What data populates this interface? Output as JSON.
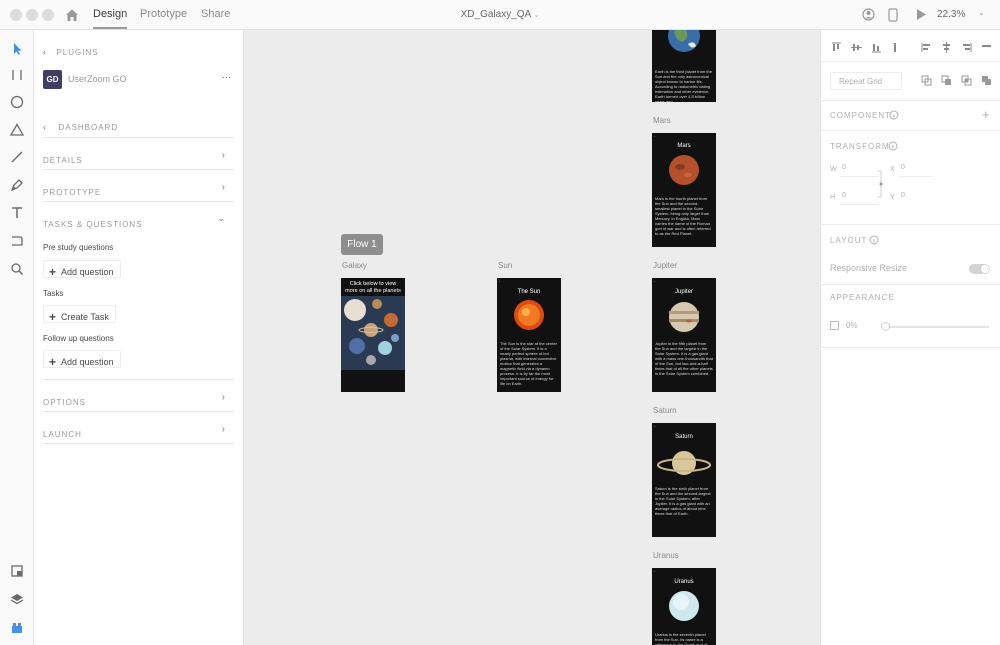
{
  "titlebar": {
    "tabs": [
      "Design",
      "Prototype",
      "Share"
    ],
    "document_title": "XD_Galaxy_QA",
    "zoom": "22.3%"
  },
  "plugin_panel": {
    "header": "PLUGINS",
    "plugin_name": "UserZoom GO",
    "plugin_logo": "GD",
    "more_label": "···",
    "back_label": "DASHBOARD",
    "sections": {
      "details": "DETAILS",
      "prototype": "PROTOTYPE",
      "tasks_questions": "TASKS & QUESTIONS",
      "options": "OPTIONS",
      "launch": "LAUNCH"
    },
    "pre_study_label": "Pre study questions",
    "add_question_1": "Add question",
    "tasks_label": "Tasks",
    "create_task": "Create Task",
    "follow_up_label": "Follow up questions",
    "add_question_2": "Add question"
  },
  "canvas": {
    "flow_label": "Flow 1",
    "artboards": {
      "galaxy": {
        "label": "Galaxy",
        "header": "Click below to view more on all the planets"
      },
      "sun": {
        "label": "Sun",
        "title": "The Sun",
        "text": "The Sun is the star at the center of the Solar System. It is a nearly perfect sphere of hot plasma, with internal convective motion that generates a magnetic field via a dynamo process. It is by far the most important source of energy for life on Earth."
      },
      "earth": {
        "text": "Earth is the third planet from the Sun and the only astronomical object known to harbor life. According to radiometric dating estimation and other evidence, Earth formed over 4.5 billion years ago."
      },
      "mars": {
        "label": "Mars",
        "title": "Mars",
        "text": "Mars is the fourth planet from the Sun and the second-smallest planet in the Solar System, being only larger than Mercury. In English, Mars carries the name of the Roman god of war and is often referred to as the Red Planet."
      },
      "jupiter": {
        "label": "Jupiter",
        "title": "Jupiter",
        "text": "Jupiter is the fifth planet from the Sun and the largest in the Solar System. It is a gas giant with a mass one-thousandth that of the Sun, but two-and-a-half times that of all the other planets in the Solar System combined."
      },
      "saturn": {
        "label": "Saturn",
        "title": "Saturn",
        "text": "Saturn is the sixth planet from the Sun and the second-largest in the Solar System, after Jupiter. It is a gas giant with an average radius of about nine times that of Earth."
      },
      "uranus": {
        "label": "Uranus",
        "title": "Uranus",
        "text": "Uranus is the seventh planet from the Sun. Its name is a reference to the Greek god of the sky."
      }
    }
  },
  "properties": {
    "repeat_grid": "Repeat Grid",
    "component": "COMPONENT",
    "transform": "TRANSFORM",
    "w_label": "W",
    "w_value": "0",
    "h_label": "H",
    "h_value": "0",
    "x_label": "X",
    "x_value": "0",
    "y_label": "Y",
    "y_value": "0",
    "layout": "LAYOUT",
    "responsive_resize": "Responsive Resize",
    "appearance": "APPEARANCE",
    "opacity": "0%"
  },
  "icons": [
    "home-icon",
    "select-icon",
    "artboard-icon",
    "ellipse-icon",
    "triangle-icon",
    "line-icon",
    "pen-icon",
    "text-icon",
    "zoom-icon",
    "plugins-icon",
    "layers-icon",
    "assets-icon"
  ],
  "colors": {
    "accent": "#4a90e2",
    "canvas": "#ececec",
    "flow_tag": "#8e8e8e"
  }
}
